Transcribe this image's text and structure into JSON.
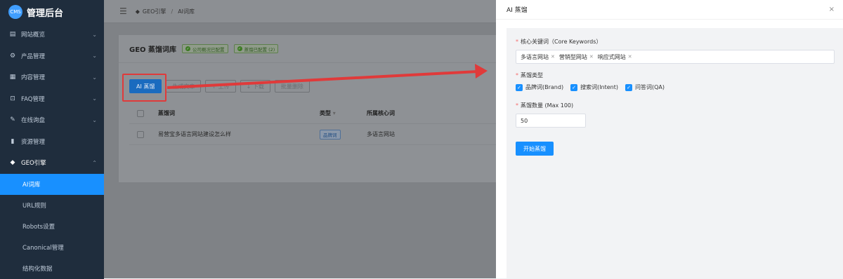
{
  "sidebar": {
    "logo_badge": "CMS",
    "logo_text": "管理后台",
    "items": [
      {
        "label": "网站概览",
        "icon": "monitor-icon",
        "glyph": "▤",
        "chevron": "⌄"
      },
      {
        "label": "产品管理",
        "icon": "gear-icon",
        "glyph": "⚙",
        "chevron": "⌄"
      },
      {
        "label": "内容管理",
        "icon": "document-icon",
        "glyph": "▦",
        "chevron": "⌄"
      },
      {
        "label": "FAQ管理",
        "icon": "book-icon",
        "glyph": "⊡",
        "chevron": "⌄"
      },
      {
        "label": "在线询盘",
        "icon": "chat-icon",
        "glyph": "✎",
        "chevron": "⌄"
      },
      {
        "label": "资源管理",
        "icon": "folder-icon",
        "glyph": "▮",
        "chevron": ""
      },
      {
        "label": "GEO引擎",
        "icon": "diamond-icon",
        "glyph": "◆",
        "chevron": "⌃"
      }
    ],
    "subitems": [
      {
        "label": "AI词库",
        "active": true
      },
      {
        "label": "URL规则",
        "active": false
      },
      {
        "label": "Robots设置",
        "active": false
      },
      {
        "label": "Canonical管理",
        "active": false
      },
      {
        "label": "结构化数据",
        "active": false
      }
    ]
  },
  "topbar": {
    "menu_icon": "☰",
    "breadcrumb_root": "GEO引擎",
    "breadcrumb_sep": "/",
    "breadcrumb_current": "AI词库"
  },
  "card": {
    "title": "GEO 蒸馏词库",
    "tag1": "公司概况已配置",
    "tag2": "蒸馏已配置 (2)",
    "buttons": {
      "ai_distill": "AI 蒸馏",
      "gen_article": "生成文章",
      "upload": "↑ 上传",
      "download": "↓ 下载",
      "batch_delete": "批量删除"
    },
    "table": {
      "headers": {
        "word": "蒸馏词",
        "type": "类型",
        "core": "所属核心词"
      },
      "rows": [
        {
          "word": "易营宝多语言网站建设怎么样",
          "type": "品牌词",
          "core": "多语言网站"
        }
      ]
    }
  },
  "drawer": {
    "title": "AI 蒸馏",
    "close": "×",
    "core_keywords_label": "核心关键词（Core Keywords）",
    "keywords": [
      "多语言网站",
      "营销型网站",
      "响应式网站"
    ],
    "distill_type_label": "蒸馏类型",
    "types": [
      "品牌词(Brand)",
      "搜索词(Intent)",
      "问答词(QA)"
    ],
    "count_label": "蒸馏数量 (Max 100)",
    "count_value": "50",
    "start_button": "开始蒸馏"
  },
  "colors": {
    "sidebar_bg": "#1f2d3d",
    "active_blue": "#1890ff",
    "arrow_red": "#e03a3a"
  }
}
